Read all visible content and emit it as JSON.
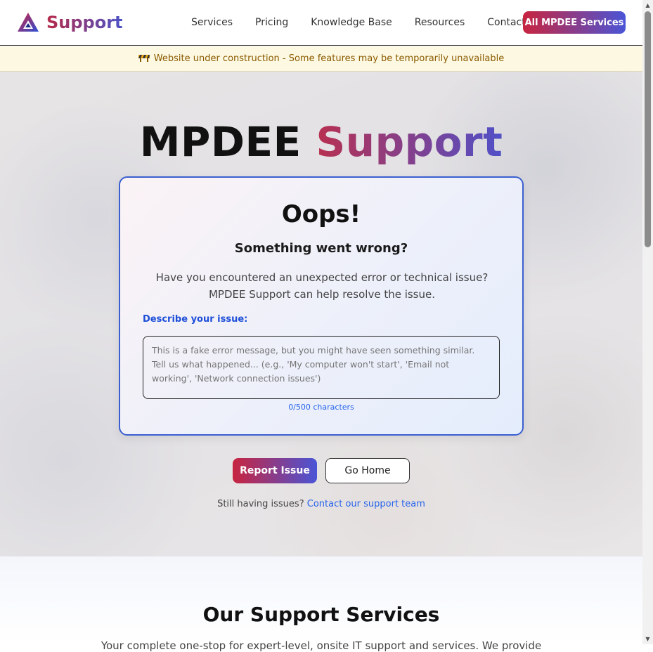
{
  "header": {
    "logo_text": "Support",
    "nav": [
      "Services",
      "Pricing",
      "Knowledge Base",
      "Resources",
      "Contact"
    ],
    "cta_label": "All MPDEE Services"
  },
  "banner": {
    "icon": "construction-barrier-icon",
    "text": "Website under construction - Some features may be temporarily unavailable"
  },
  "hero": {
    "title_main": "MPDEE",
    "title_accent": "Support"
  },
  "card": {
    "heading": "Oops!",
    "subheading": "Something went wrong?",
    "description": "Have you encountered an unexpected error or technical issue? MPDEE Support can help resolve the issue.",
    "field_label": "Describe your issue:",
    "textarea_placeholder": "This is a fake error message, but you might have seen something similar. Tell us what happened... (e.g., 'My computer won't start', 'Email not working', 'Network connection issues')",
    "textarea_value": "",
    "counter": "0/500 characters"
  },
  "actions": {
    "report_label": "Report Issue",
    "home_label": "Go Home",
    "help_text": "Still having issues?",
    "help_link": "Contact our support team"
  },
  "services": {
    "title": "Our Support Services",
    "description": "Your complete one-stop for expert-level, onsite IT support and services. We provide"
  },
  "colors": {
    "accent_red": "#c8243f",
    "accent_blue": "#4a55d6",
    "link_blue": "#2563eb",
    "banner_bg": "#fdf8e1"
  }
}
